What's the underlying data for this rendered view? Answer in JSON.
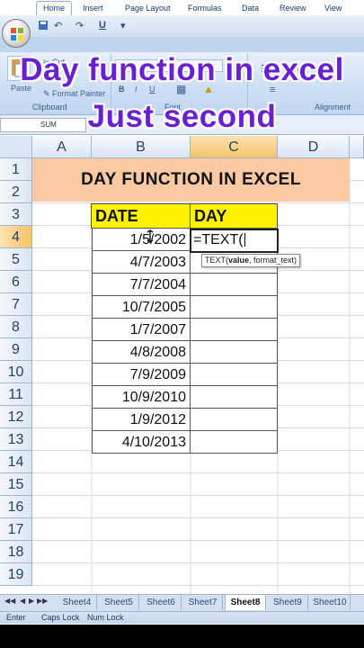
{
  "overlay": {
    "line1": "Day function in excel",
    "line2": "Just second"
  },
  "ribbon": {
    "tabs": [
      "Home",
      "Insert",
      "Page Layout",
      "Formulas",
      "Data",
      "Review",
      "View"
    ],
    "active_tab": "Home",
    "paste_label": "Paste",
    "cut_label": "Cut",
    "format_painter_label": "Format Painter",
    "groups": {
      "clipboard": "Clipboard",
      "font": "Font",
      "alignment": "Alignment"
    },
    "bold": "B",
    "italic": "I",
    "underline": "U"
  },
  "formula_bar": {
    "name_box": "SUM"
  },
  "columns": [
    "A",
    "B",
    "C",
    "D"
  ],
  "rows": [
    "1",
    "2",
    "3",
    "4",
    "5",
    "6",
    "7",
    "8",
    "9",
    "10",
    "11",
    "12",
    "13",
    "14",
    "15",
    "16",
    "17",
    "18",
    "19"
  ],
  "sheet": {
    "title": "DAY  FUNCTION IN EXCEL",
    "headers": {
      "date": "DATE",
      "day": "DAY"
    },
    "dates": [
      "1/5/2002",
      "4/7/2003",
      "7/7/2004",
      "10/7/2005",
      "1/7/2007",
      "4/8/2008",
      "7/9/2009",
      "10/9/2010",
      "1/9/2012",
      "4/10/2013"
    ],
    "editing_formula": "=TEXT(",
    "tooltip": {
      "fn": "TEXT(",
      "arg1": "value",
      "rest": ", format_text)"
    }
  },
  "sheet_tabs": [
    "Sheet4",
    "Sheet5",
    "Sheet6",
    "Sheet7",
    "Sheet8",
    "Sheet9",
    "Sheet10"
  ],
  "active_sheet": "Sheet8",
  "status": {
    "mode": "Enter",
    "caps": "Caps Lock",
    "num": "Num Lock"
  },
  "colors": {
    "title_fill": "#fbc9a3",
    "header_fill": "#fff200",
    "overlay_text": "#6a1fd1"
  }
}
